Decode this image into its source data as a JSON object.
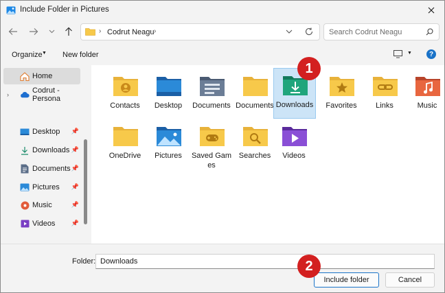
{
  "window": {
    "title": "Include Folder in Pictures"
  },
  "address_bar": {
    "crumb": "Codrut Neagu",
    "separator": "›"
  },
  "search": {
    "placeholder": "Search Codrut Neagu"
  },
  "toolbar": {
    "organize_label": "Organize",
    "new_folder_label": "New folder",
    "help_label": "?"
  },
  "sidebar": {
    "items": [
      {
        "label": "Home",
        "icon": "home-icon",
        "selected": true
      },
      {
        "label": "Codrut - Persona",
        "icon": "cloud-icon",
        "expandable": true
      },
      {
        "label": "Desktop",
        "icon": "desktop-icon",
        "pinned": true
      },
      {
        "label": "Downloads",
        "icon": "download-icon",
        "pinned": true
      },
      {
        "label": "Documents",
        "icon": "documents-icon",
        "pinned": true
      },
      {
        "label": "Pictures",
        "icon": "pictures-icon",
        "pinned": true
      },
      {
        "label": "Music",
        "icon": "music-icon",
        "pinned": true
      },
      {
        "label": "Videos",
        "icon": "videos-icon",
        "pinned": true
      }
    ]
  },
  "folders": [
    {
      "label": "Contacts",
      "icon": "contacts-folder-icon"
    },
    {
      "label": "Desktop",
      "icon": "desktop-folder-icon"
    },
    {
      "label": "Documents",
      "icon": "documents-folder-icon"
    },
    {
      "label": "Documents",
      "icon": "plain-folder-icon"
    },
    {
      "label": "Downloads",
      "icon": "downloads-folder-icon",
      "selected": true
    },
    {
      "label": "Favorites",
      "icon": "favorites-folder-icon"
    },
    {
      "label": "Links",
      "icon": "links-folder-icon"
    },
    {
      "label": "Music",
      "icon": "music-folder-icon"
    },
    {
      "label": "OneDrive",
      "icon": "onedrive-folder-icon"
    },
    {
      "label": "Pictures",
      "icon": "pictures-folder-icon"
    },
    {
      "label": "Saved Games",
      "icon": "saved-games-folder-icon"
    },
    {
      "label": "Searches",
      "icon": "searches-folder-icon"
    },
    {
      "label": "Videos",
      "icon": "videos-folder-icon"
    }
  ],
  "footer": {
    "folder_label": "Folder:",
    "folder_value": "Downloads",
    "include_button": "Include folder",
    "cancel_button": "Cancel"
  },
  "annotations": {
    "badge1": "1",
    "badge2": "2"
  },
  "colors": {
    "accent": "#1a73c8",
    "selection": "#cce4f7",
    "badge": "#d32020",
    "folder_yellow": "#f7c94a"
  }
}
